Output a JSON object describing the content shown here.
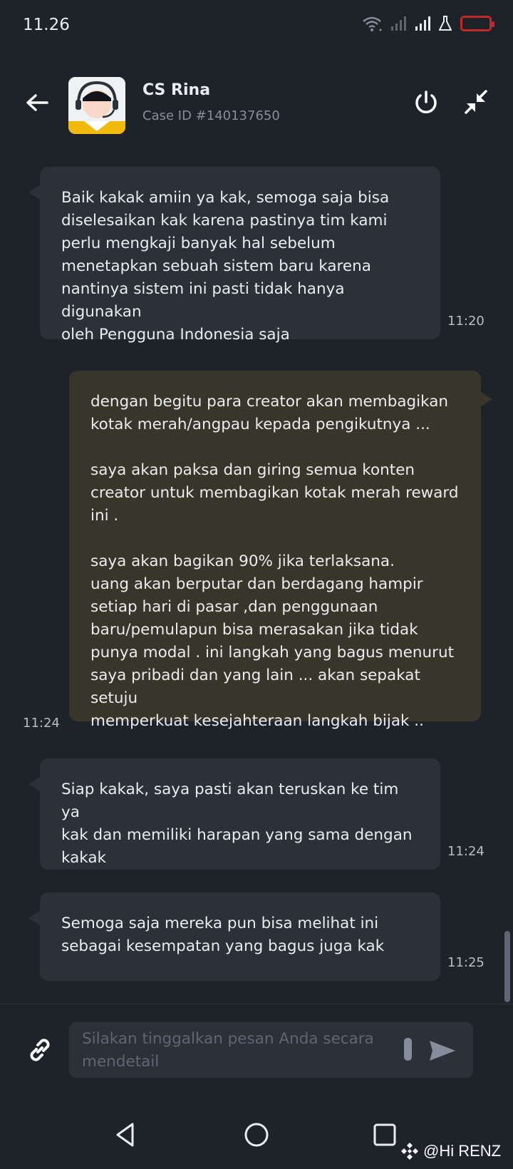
{
  "status_bar": {
    "time": "11.26"
  },
  "header": {
    "agent_name": "CS Rina",
    "case_id": "Case ID #140137650"
  },
  "messages": [
    {
      "direction": "incoming",
      "text": "Baik kakak amiin ya kak, semoga saja bisa\ndiselesaikan kak karena pastinya tim kami\nperlu mengkaji banyak hal sebelum\nmenetapkan sebuah sistem baru karena\nnantinya sistem ini pasti tidak hanya digunakan\noleh Pengguna Indonesia saja",
      "time": "11:20"
    },
    {
      "direction": "outgoing",
      "text": "dengan begitu para creator akan membagikan\nkotak merah/angpau kepada pengikutnya ...\n\nsaya akan paksa dan giring semua konten\ncreator untuk membagikan kotak merah reward\nini .\n\nsaya akan bagikan 90% jika terlaksana.\nuang akan berputar dan berdagang hampir\nsetiap hari di pasar ,dan penggunaan\nbaru/pemulapun bisa merasakan jika tidak\npunya modal . ini langkah yang bagus menurut\nsaya pribadi dan yang lain ... akan sepakat setuju\nmemperkuat kesejahteraan langkah bijak ..",
      "time": "11:24"
    },
    {
      "direction": "incoming",
      "text": "Siap kakak, saya pasti akan teruskan ke tim ya\nkak dan memiliki harapan yang sama dengan\nkakak",
      "time": "11:24"
    },
    {
      "direction": "incoming",
      "text": "Semoga saja mereka pun bisa melihat ini\nsebagai kesempatan yang bagus juga kak",
      "time": "11:25"
    }
  ],
  "input": {
    "placeholder": "Silakan tinggalkan pesan Anda secara mendetail"
  },
  "watermark": "@Hi RENZ",
  "colors": {
    "background": "#1e2329",
    "incoming_bubble": "#2b3139",
    "outgoing_bubble": "#38352b",
    "text": "#eaecef",
    "muted_text": "#848e9c",
    "battery_warning": "#c0282a"
  },
  "icons": [
    "back-arrow-icon",
    "agent-avatar-icon",
    "power-icon",
    "collapse-icon",
    "link-icon",
    "send-icon",
    "nav-back-icon",
    "nav-home-icon",
    "nav-recents-icon",
    "wifi-icon",
    "signal-icon",
    "battery-icon"
  ]
}
